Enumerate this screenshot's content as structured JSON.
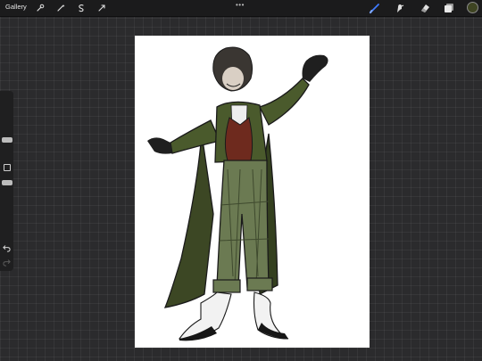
{
  "topbar": {
    "gallery_label": "Gallery",
    "more_label": "•••",
    "left_tools": [
      "wrench-icon",
      "magic-wand-icon",
      "selection-icon",
      "transform-icon"
    ],
    "right_tools": [
      "brush-icon",
      "smudge-icon",
      "eraser-icon",
      "layers-icon"
    ],
    "active_tool": "brush-icon",
    "current_color": "#3e4422"
  },
  "sidebar": {
    "brush_size_level": 0.25,
    "opacity_level": 0.5
  }
}
